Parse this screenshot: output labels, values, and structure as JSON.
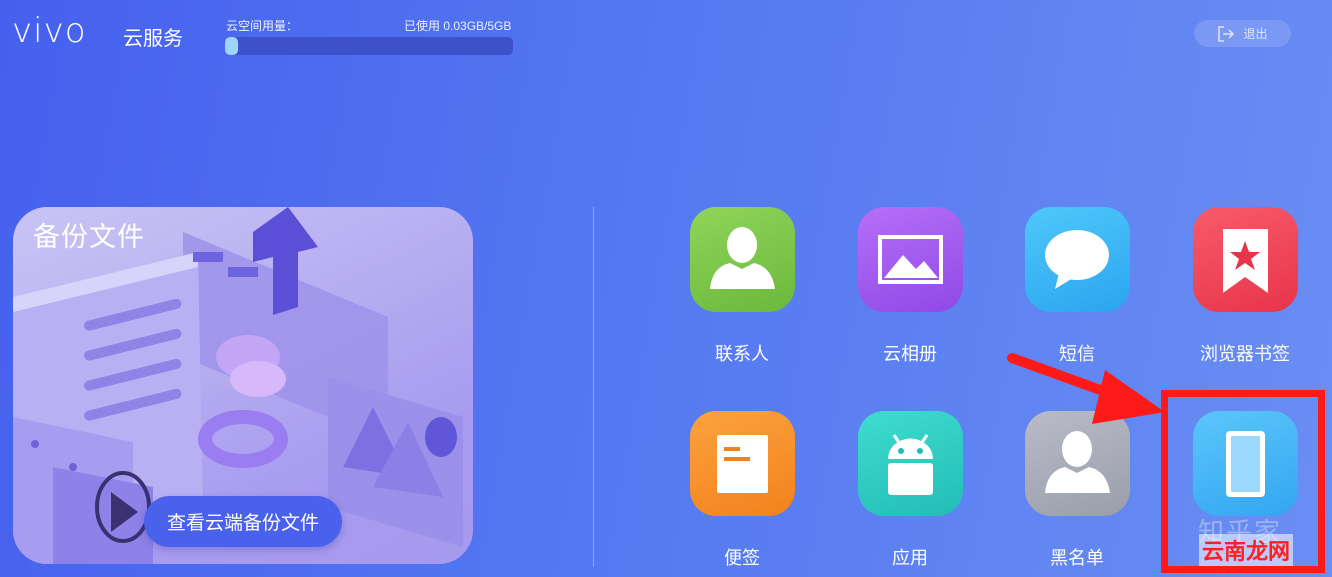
{
  "header": {
    "logo": "vivo",
    "service": "云服务",
    "storage_label": "云空间用量：",
    "storage_used": "已使用 0.03GB/5GB",
    "storage_fraction": 0.006,
    "logout": "退出"
  },
  "backup": {
    "title": "备份文件",
    "button": "查看云端备份文件"
  },
  "apps": [
    {
      "label": "联系人",
      "icon": "contact-icon",
      "color": "#7cc64a"
    },
    {
      "label": "云相册",
      "icon": "album-icon",
      "color": "#a45cf0"
    },
    {
      "label": "短信",
      "icon": "message-icon",
      "color": "#3ab8f5"
    },
    {
      "label": "浏览器书签",
      "icon": "bookmark-icon",
      "color": "#f3455a"
    },
    {
      "label": "便签",
      "icon": "note-icon",
      "color": "#f8922c"
    },
    {
      "label": "应用",
      "icon": "android-icon",
      "color": "#2fcfc5"
    },
    {
      "label": "黑名单",
      "icon": "blacklist-icon",
      "color": "#a9adb9"
    },
    {
      "label": "",
      "icon": "phone-icon",
      "color": "#45b5f7"
    }
  ],
  "annotation": {
    "highlight_color": "#ff1a1a",
    "watermark": "云南龙网",
    "watermark_ghost": "知乎家"
  }
}
